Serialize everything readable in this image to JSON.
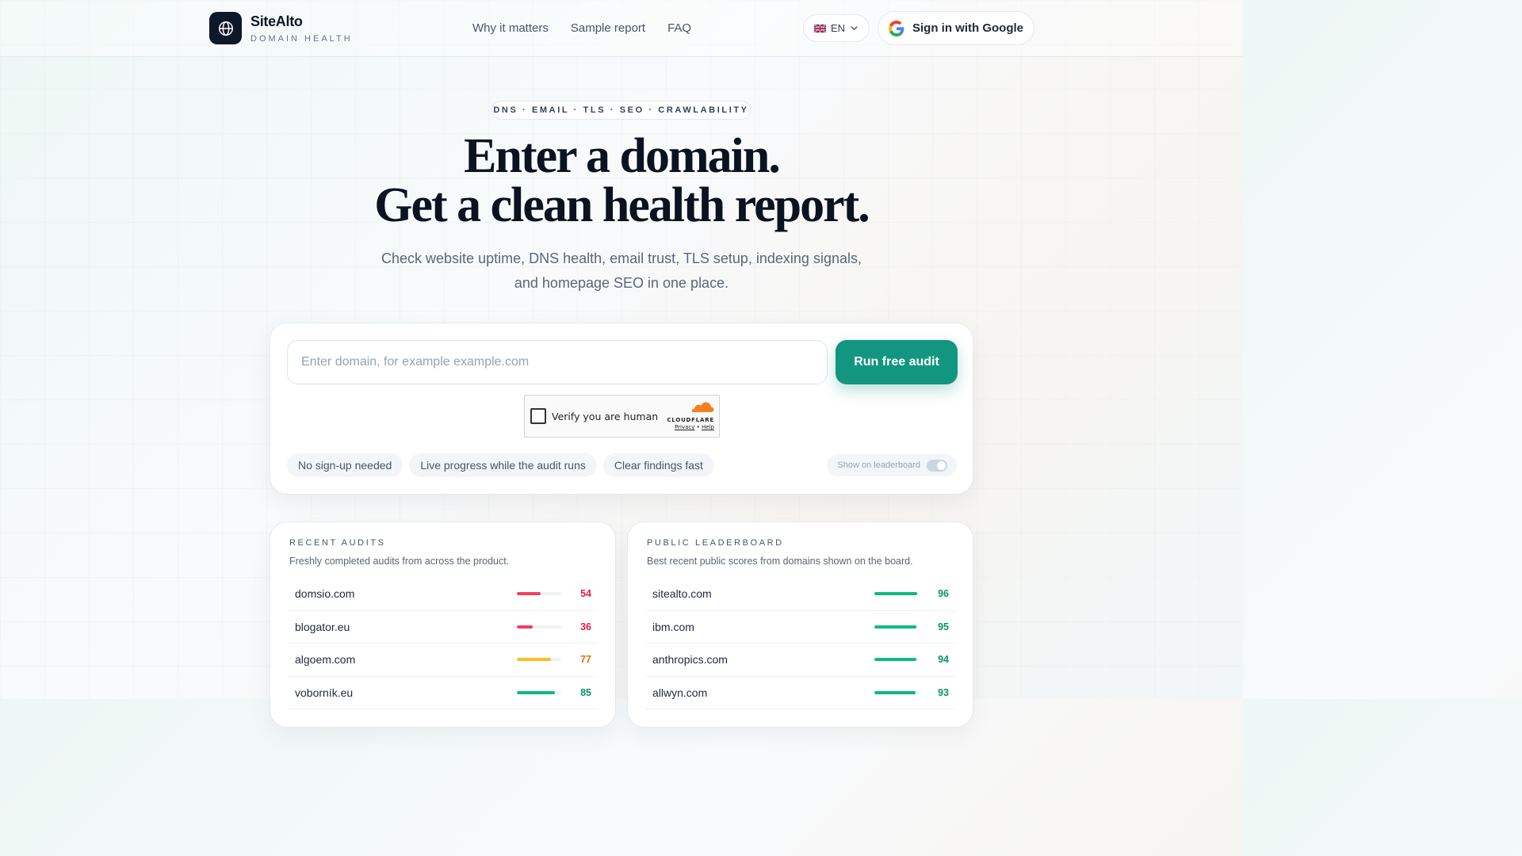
{
  "brand": {
    "name": "SiteAlto",
    "tagline": "DOMAIN HEALTH"
  },
  "nav": [
    {
      "label": "Why it matters"
    },
    {
      "label": "Sample report"
    },
    {
      "label": "FAQ"
    }
  ],
  "language": {
    "code": "EN",
    "flag_icon": "uk-flag-icon"
  },
  "signin": {
    "label": "Sign in with Google"
  },
  "hero": {
    "topics": "DNS · EMAIL · TLS · SEO · CRAWLABILITY",
    "headline_line1": "Enter a domain.",
    "headline_line2": "Get a clean health report.",
    "subtitle_line1": "Check website uptime, DNS health, email trust, TLS setup, indexing signals,",
    "subtitle_line2": "and homepage SEO in one place."
  },
  "audit": {
    "input_placeholder": "Enter domain, for example example.com",
    "input_value": "",
    "run_button": "Run free audit",
    "captcha": {
      "label": "Verify you are human",
      "provider": "CLOUDFLARE",
      "privacy": "Privacy",
      "separator": "•",
      "help": "Help"
    },
    "chips": [
      "No sign-up needed",
      "Live progress while the audit runs",
      "Clear findings fast"
    ],
    "leaderboard_toggle": {
      "label": "Show on leaderboard",
      "on": false
    }
  },
  "recent": {
    "title": "RECENT AUDITS",
    "description": "Freshly completed audits from across the product.",
    "rows": [
      {
        "domain": "domsio.com",
        "score": 54,
        "color": "#e11d48"
      },
      {
        "domain": "blogator.eu",
        "score": 36,
        "color": "#e11d48"
      },
      {
        "domain": "algoem.com",
        "score": 77,
        "color": "#d97706"
      },
      {
        "domain": "voborník.eu",
        "score": 85,
        "color": "#059669"
      }
    ]
  },
  "leaderboard": {
    "title": "PUBLIC LEADERBOARD",
    "description": "Best recent public scores from domains shown on the board.",
    "rows": [
      {
        "domain": "sitealto.com",
        "score": 96,
        "color": "#059669"
      },
      {
        "domain": "ibm.com",
        "score": 95,
        "color": "#059669"
      },
      {
        "domain": "anthropics.com",
        "score": 94,
        "color": "#059669"
      },
      {
        "domain": "allwyn.com",
        "score": 93,
        "color": "#059669"
      }
    ]
  },
  "colors": {
    "accent": "#139680",
    "bad": "#e11d48",
    "warn": "#d97706",
    "good": "#059669",
    "bar_bad": "#f43f5e",
    "bar_warn": "#fbbf24",
    "bar_good": "#10b981"
  }
}
